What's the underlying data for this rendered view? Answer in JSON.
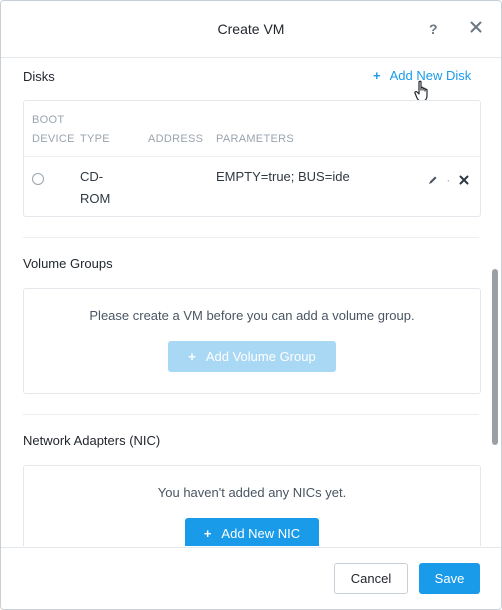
{
  "dialog": {
    "title": "Create VM",
    "help_label": "?",
    "close_label": "✕"
  },
  "disks": {
    "title": "Disks",
    "add_label": "Add New Disk",
    "columns": {
      "boot_line1": "BOOT",
      "boot_line2": "DEVICE",
      "type": "TYPE",
      "address": "ADDRESS",
      "parameters": "PARAMETERS"
    },
    "rows": [
      {
        "type_line1": "CD-",
        "type_line2": "ROM",
        "address": "",
        "parameters": "EMPTY=true; BUS=ide",
        "edit_icon": "pencil-icon",
        "separator": "·",
        "delete_icon": "close-icon"
      }
    ]
  },
  "volume_groups": {
    "title": "Volume Groups",
    "empty_text": "Please create a VM before you can add a volume group.",
    "add_label": "Add Volume Group"
  },
  "nics": {
    "title": "Network Adapters (NIC)",
    "empty_text": "You haven't added any NICs yet.",
    "add_label": "Add New NIC"
  },
  "footer": {
    "cancel_label": "Cancel",
    "save_label": "Save"
  },
  "colors": {
    "accent": "#1a9bea",
    "disabled": "#a9d8f5"
  },
  "icons": {
    "plus": "+",
    "pencil": "✎",
    "delete": "✖"
  }
}
